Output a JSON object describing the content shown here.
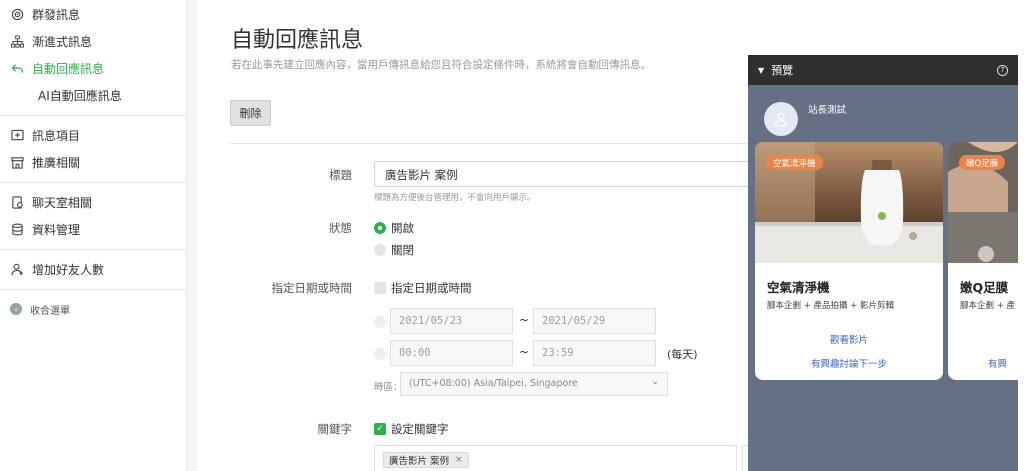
{
  "sidebar": {
    "items": [
      {
        "label": "群發訊息",
        "icon": "broadcast-icon"
      },
      {
        "label": "漸進式訊息",
        "icon": "step-tree-icon"
      },
      {
        "label": "自動回應訊息",
        "icon": "reply-arrow-icon",
        "active": true
      },
      {
        "label": "AI自動回應訊息"
      },
      {
        "label": "訊息項目",
        "icon": "message-plus-icon"
      },
      {
        "label": "推廣相關",
        "icon": "store-icon"
      },
      {
        "label": "聊天室相關",
        "icon": "chat-doc-icon"
      },
      {
        "label": "資料管理",
        "icon": "database-icon"
      },
      {
        "label": "增加好友人數",
        "icon": "add-user-icon"
      }
    ],
    "collapse_label": "收合選單"
  },
  "main": {
    "title": "自動回應訊息",
    "description": "若在此事先建立回應內容，當用戶傳訊息給您且符合設定條件時，系統將會自動回傳訊息。",
    "delete_label": "刪除"
  },
  "form": {
    "title_label": "標題",
    "title_value": "廣告影片 案例",
    "title_hint": "標題為方便後台管理用，不會向用戶顯示。",
    "status_label": "狀態",
    "status_on": "開啟",
    "status_off": "關閉",
    "schedule_label": "指定日期或時間",
    "schedule_checkbox": "指定日期或時間",
    "date_from": "2021/05/23",
    "date_to": "2021/05/29",
    "time_from": "00:00",
    "time_to": "23:59",
    "tilde": "~",
    "daily": "(每天)",
    "timezone_label": "時區：",
    "timezone_value": "(UTC+08:00) Asia/Taipei, Singapore",
    "keyword_label": "關鍵字",
    "keyword_checkbox": "設定關鍵字",
    "keyword_tag": "廣告影片 案例",
    "keyword_tag_remove": "×"
  },
  "preview": {
    "header": "預覽",
    "account_name": "站長測試",
    "cards": [
      {
        "tag": "空氣清淨機",
        "title": "空氣清淨機",
        "subtitle": "腳本企劃 + 產品拍攝 + 影片剪輯",
        "action1": "觀看影片",
        "action2": "有興趣討論下一步"
      },
      {
        "tag": "嫩Q足膜",
        "title": "嫩Q足膜",
        "subtitle": "腳本企劃 + 產",
        "action1": "",
        "action2": "有興"
      }
    ]
  },
  "colors": {
    "accent": "#2cb24b",
    "link": "#3b63c4",
    "tag": "#e8854a",
    "preview_bg": "#667085"
  }
}
